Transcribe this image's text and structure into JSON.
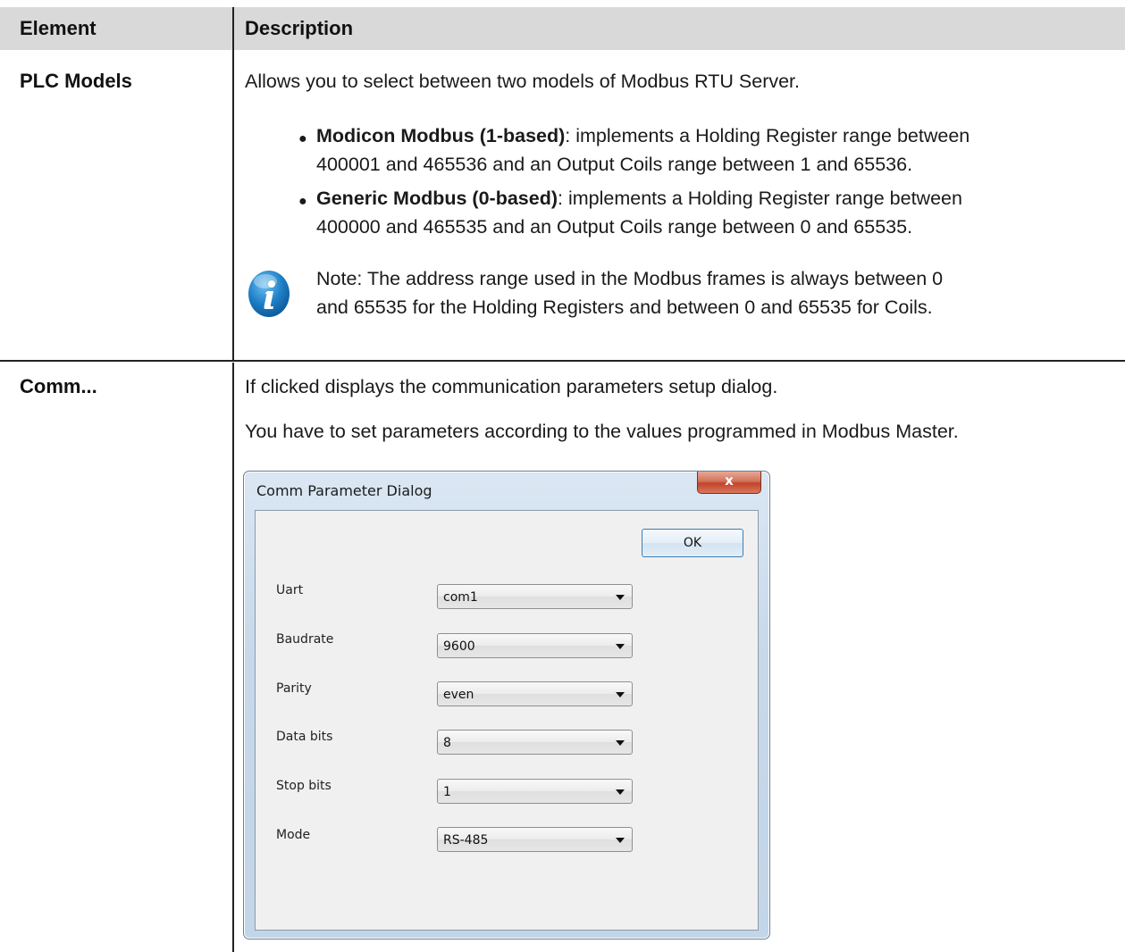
{
  "table": {
    "headers": {
      "element": "Element",
      "description": "Description"
    },
    "rows": [
      {
        "element": "PLC Models",
        "intro": "Allows you to select between two models of Modbus RTU Server.",
        "bullets": [
          {
            "term": "Modicon Modbus (1-based)",
            "line1": ": implements a Holding Register range between",
            "line2": "400001 and 465536 and an Output Coils range between 1 and 65536."
          },
          {
            "term": "Generic Modbus (0-based)",
            "line1": ": implements a Holding Register range between",
            "line2": "400000 and 465535 and an Output Coils range between 0 and 65535."
          }
        ],
        "note_line1": "Note: The address range used in the Modbus frames is always between 0",
        "note_line2": "and 65535 for the Holding Registers and between 0 and 65535 for Coils."
      },
      {
        "element": "Comm...",
        "para1": "If clicked displays the communication parameters setup dialog.",
        "para2": "You have to set parameters according to the values programmed in Modbus Master."
      }
    ]
  },
  "dialog": {
    "title": "Comm Parameter Dialog",
    "close_glyph": "x",
    "ok_label": "OK",
    "fields": [
      {
        "label": "Uart",
        "value": "com1"
      },
      {
        "label": "Baudrate",
        "value": "9600"
      },
      {
        "label": "Parity",
        "value": "even"
      },
      {
        "label": "Data bits",
        "value": "8"
      },
      {
        "label": "Stop bits",
        "value": "1"
      },
      {
        "label": "Mode",
        "value": "RS-485"
      }
    ]
  },
  "icons": {
    "info": "info-icon",
    "bullet": "bullet-dot",
    "dropdown": "chevron-down-icon",
    "close": "close-icon"
  },
  "colors": {
    "header_bg": "#d9d9d9",
    "info_icon": "#1f7fc6",
    "dialog_close": "#c2432a"
  }
}
